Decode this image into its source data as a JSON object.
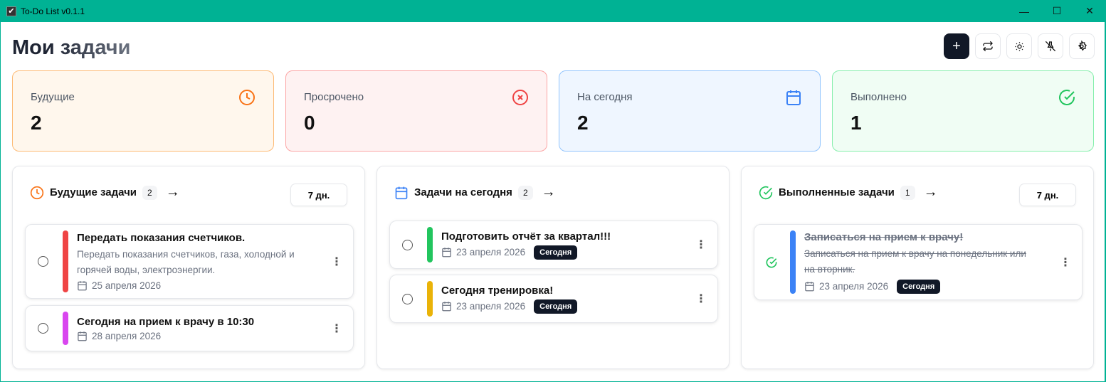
{
  "window": {
    "title": "To-Do List v0.1.1",
    "minimize": "—",
    "maximize": "☐",
    "close": "✕"
  },
  "header": {
    "title": "Мои задачи",
    "add": "+"
  },
  "stats": [
    {
      "label": "Будущие",
      "value": "2",
      "color": "#f97316"
    },
    {
      "label": "Просрочено",
      "value": "0",
      "color": "#ef4444"
    },
    {
      "label": "На сегодня",
      "value": "2",
      "color": "#3b82f6"
    },
    {
      "label": "Выполнено",
      "value": "1",
      "color": "#22c55e"
    }
  ],
  "columns": [
    {
      "title": "Будущие задачи",
      "count": "2",
      "range": "7 дн.",
      "tasks": [
        {
          "title": "Передать показания счетчиков.",
          "description": "Передать показания счетчиков, газа, холодной и горячей воды, электроэнергии.",
          "date": "25 апреля 2026",
          "color": "#ef4444"
        },
        {
          "title": "Сегодня на прием к врачу в 10:30",
          "date": "28 апреля 2026",
          "color": "#d946ef"
        }
      ]
    },
    {
      "title": "Задачи на сегодня",
      "count": "2",
      "tasks": [
        {
          "title": "Подготовить отчёт за квартал!!!",
          "date": "23 апреля 2026",
          "tag": "Сегодня",
          "color": "#22c55e"
        },
        {
          "title": "Сегодня тренировка!",
          "date": "23 апреля 2026",
          "tag": "Сегодня",
          "color": "#eab308"
        }
      ]
    },
    {
      "title": "Выполненные задачи",
      "count": "1",
      "range": "7 дн.",
      "tasks": [
        {
          "title": "Записаться на прием к врачу!",
          "description": "Записаться на прием к врачу на понедельник или на вторник.",
          "date": "23 апреля 2026",
          "tag": "Сегодня",
          "color": "#3b82f6",
          "done": true
        }
      ]
    }
  ]
}
